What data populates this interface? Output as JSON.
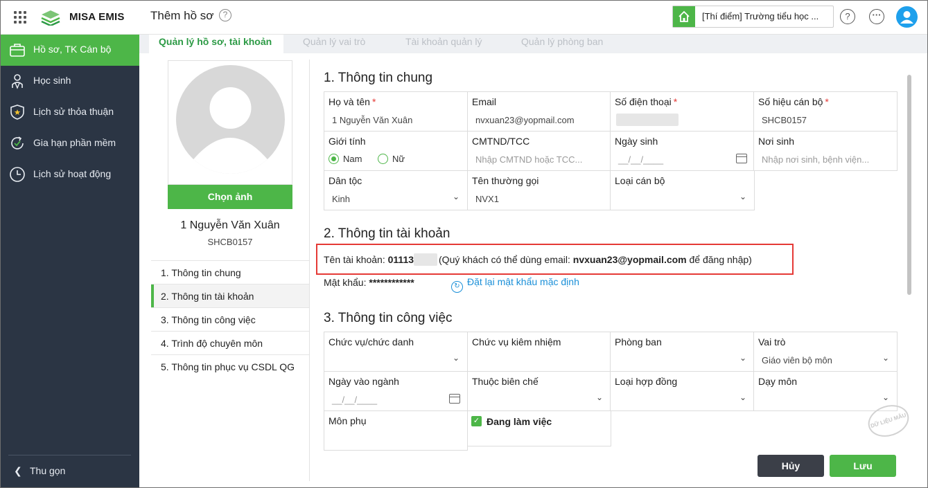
{
  "app": {
    "logo_text": "MISA EMIS",
    "page_title": "Thêm hồ sơ",
    "school": "[Thí điểm] Trường tiểu học ..."
  },
  "icons": {
    "apps": "apps-grid-icon",
    "help": "help-icon",
    "more": "more-icon",
    "home": "home-icon",
    "user": "user-avatar-icon"
  },
  "colors": {
    "accent": "#4db648",
    "sidebar": "#2b3544",
    "link": "#1a8fd8",
    "highlight": "#e53935"
  },
  "sidebar": {
    "items": [
      {
        "label": "Hồ sơ, TK Cán bộ",
        "icon": "briefcase-icon",
        "active": true
      },
      {
        "label": "Học sinh",
        "icon": "student-icon"
      },
      {
        "label": "Lịch sử thỏa thuận",
        "icon": "shield-star-icon"
      },
      {
        "label": "Gia hạn phần mềm",
        "icon": "renew-icon"
      },
      {
        "label": "Lịch sử hoạt động",
        "icon": "clock-icon"
      }
    ],
    "collapse_label": "Thu gọn"
  },
  "tabs": [
    "Quản lý hồ sơ, tài khoản",
    "Quản lý vai trò",
    "Tài khoản quản lý",
    "Quản lý phòng ban"
  ],
  "profile": {
    "choose_photo": "Chọn ảnh",
    "name": "1 Nguyễn Văn Xuân",
    "code": "SHCB0157",
    "nav": [
      "1. Thông tin chung",
      "2. Thông tin tài khoản",
      "3. Thông tin công việc",
      "4. Trình độ chuyên môn",
      "5. Thông tin phục vụ CSDL QG"
    ]
  },
  "general": {
    "title": "1. Thông tin chung",
    "fullname": {
      "label": "Họ và tên",
      "value": "1 Nguyễn Văn Xuân"
    },
    "email": {
      "label": "Email",
      "value": "nvxuan23@yopmail.com"
    },
    "phone": {
      "label": "Số điện thoại"
    },
    "staff_code": {
      "label": "Số hiệu cán bộ",
      "value": "SHCB0157"
    },
    "gender": {
      "label": "Giới tính",
      "options": [
        "Nam",
        "Nữ"
      ],
      "selected": "Nam"
    },
    "id_card": {
      "label": "CMTND/TCC",
      "placeholder": "Nhập CMTND hoặc TCC..."
    },
    "birthday": {
      "label": "Ngày sinh",
      "placeholder": "__/__/____"
    },
    "birthplace": {
      "label": "Nơi sinh",
      "placeholder": "Nhập nơi sinh, bệnh viện..."
    },
    "ethnic": {
      "label": "Dân tộc",
      "value": "Kinh"
    },
    "nickname": {
      "label": "Tên thường gọi",
      "value": "NVX1"
    },
    "staff_type": {
      "label": "Loại cán bộ"
    }
  },
  "account": {
    "title": "2. Thông tin tài khoản",
    "username_label": "Tên tài khoản:",
    "username": "01113",
    "note_prefix": "(Quý khách có thể dùng email:",
    "note_email": "nvxuan23@yopmail.com",
    "note_suffix": "để đăng nhập)",
    "password_label": "Mật khẩu:",
    "password": "************",
    "reset_label": "Đặt lại mật khẩu mặc định"
  },
  "work": {
    "title": "3. Thông tin công việc",
    "position": {
      "label": "Chức vụ/chức danh"
    },
    "concurrent": {
      "label": "Chức vụ kiêm nhiệm"
    },
    "department": {
      "label": "Phòng ban"
    },
    "role": {
      "label": "Vai trò",
      "value": "Giáo viên bộ môn"
    },
    "start_date": {
      "label": "Ngày vào ngành",
      "placeholder": "__/__/____"
    },
    "payroll": {
      "label": "Thuộc biên chế"
    },
    "contract": {
      "label": "Loại hợp đồng"
    },
    "teaching": {
      "label": "Dạy môn"
    },
    "minor": {
      "label": "Môn phụ"
    },
    "working": {
      "label": "Đang làm việc",
      "checked": true
    }
  },
  "watermark": "DỮ LIỆU MẪU",
  "buttons": {
    "cancel": "Hủy",
    "save": "Lưu"
  }
}
